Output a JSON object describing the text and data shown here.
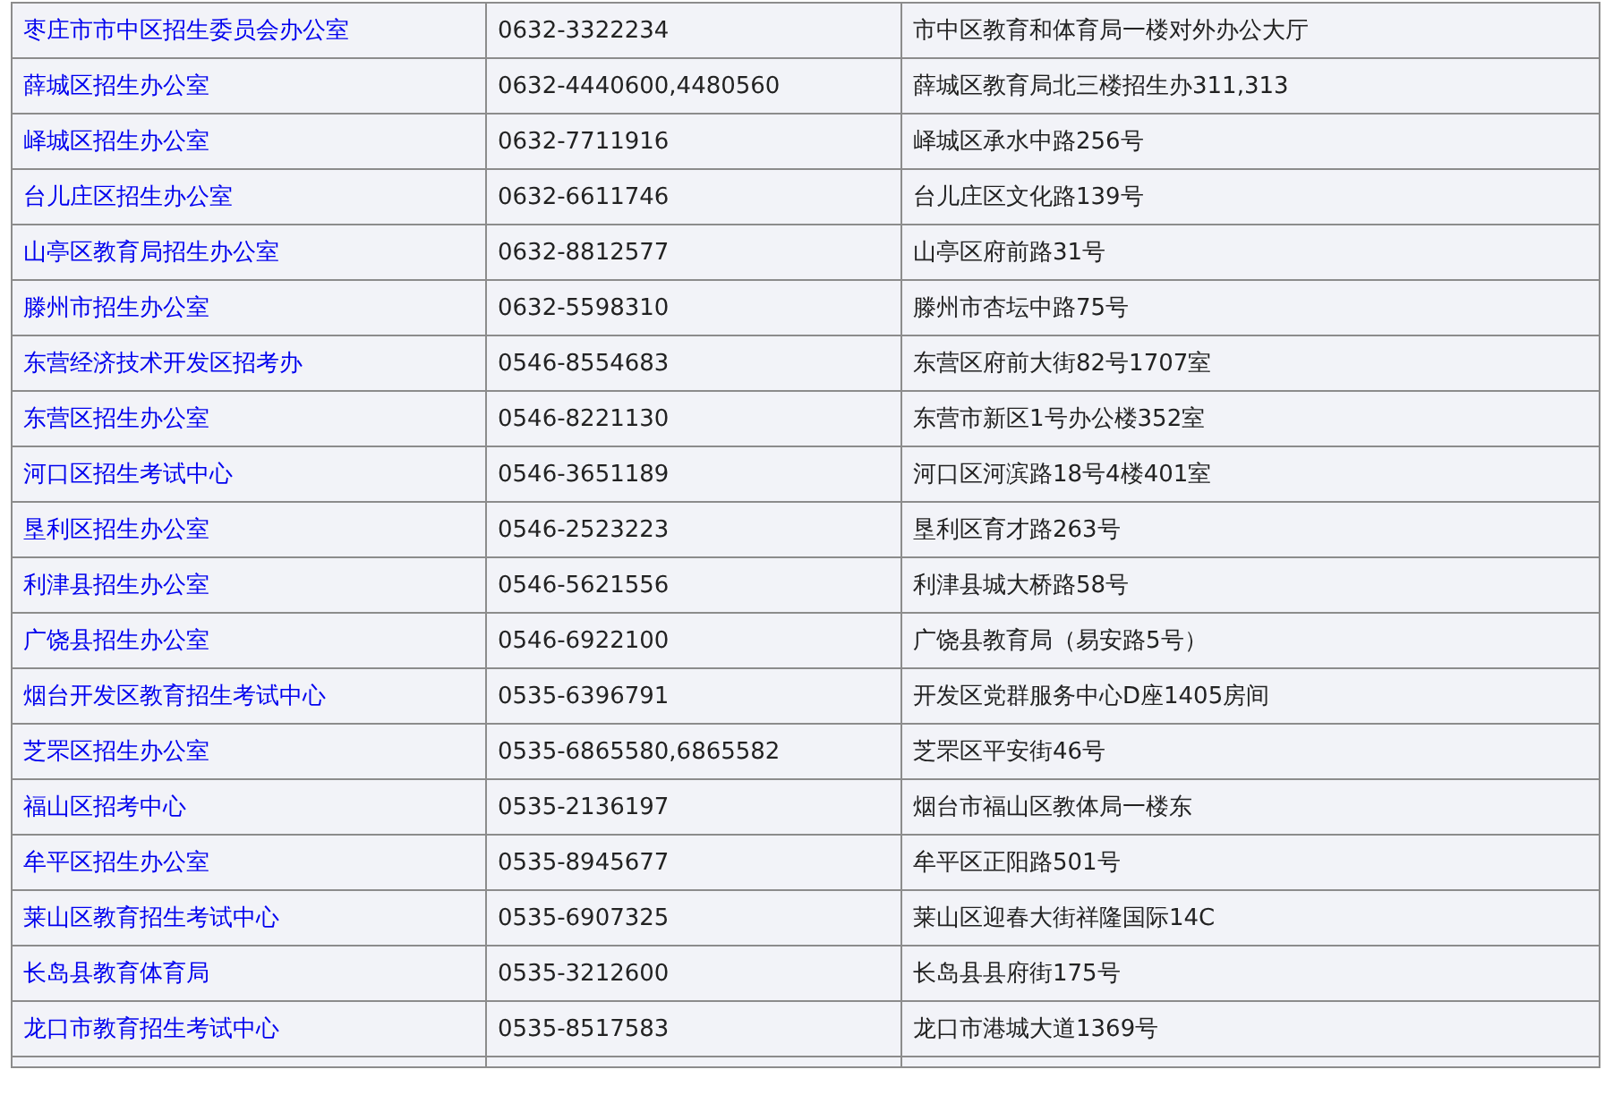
{
  "table": {
    "rows": [
      {
        "office": "枣庄市市中区招生委员会办公室",
        "phone": "0632-3322234",
        "address": "市中区教育和体育局一楼对外办公大厅"
      },
      {
        "office": "薛城区招生办公室",
        "phone": "0632-4440600,4480560",
        "address": "薛城区教育局北三楼招生办311,313"
      },
      {
        "office": "峄城区招生办公室",
        "phone": "0632-7711916",
        "address": "峄城区承水中路256号"
      },
      {
        "office": "台儿庄区招生办公室",
        "phone": "0632-6611746",
        "address": "台儿庄区文化路139号"
      },
      {
        "office": "山亭区教育局招生办公室",
        "phone": "0632-8812577",
        "address": "山亭区府前路31号"
      },
      {
        "office": "滕州市招生办公室",
        "phone": "0632-5598310",
        "address": "滕州市杏坛中路75号"
      },
      {
        "office": "东营经济技术开发区招考办",
        "phone": "0546-8554683",
        "address": "东营区府前大街82号1707室"
      },
      {
        "office": "东营区招生办公室",
        "phone": "0546-8221130",
        "address": "东营市新区1号办公楼352室"
      },
      {
        "office": "河口区招生考试中心",
        "phone": "0546-3651189",
        "address": "河口区河滨路18号4楼401室"
      },
      {
        "office": "垦利区招生办公室",
        "phone": "0546-2523223",
        "address": "垦利区育才路263号"
      },
      {
        "office": "利津县招生办公室",
        "phone": "0546-5621556",
        "address": "利津县城大桥路58号"
      },
      {
        "office": "广饶县招生办公室",
        "phone": "0546-6922100",
        "address": "广饶县教育局（易安路5号）"
      },
      {
        "office": "烟台开发区教育招生考试中心",
        "phone": "0535-6396791",
        "address": "开发区党群服务中心D座1405房间"
      },
      {
        "office": "芝罘区招生办公室",
        "phone": "0535-6865580,6865582",
        "address": "芝罘区平安街46号"
      },
      {
        "office": "福山区招考中心",
        "phone": "0535-2136197",
        "address": "烟台市福山区教体局一楼东"
      },
      {
        "office": "牟平区招生办公室",
        "phone": "0535-8945677",
        "address": "牟平区正阳路501号"
      },
      {
        "office": "莱山区教育招生考试中心",
        "phone": "0535-6907325",
        "address": "莱山区迎春大街祥隆国际14C"
      },
      {
        "office": "长岛县教育体育局",
        "phone": "0535-3212600",
        "address": "长岛县县府街175号"
      },
      {
        "office": "龙口市教育招生考试中心",
        "phone": "0535-8517583",
        "address": "龙口市港城大道1369号"
      }
    ]
  }
}
